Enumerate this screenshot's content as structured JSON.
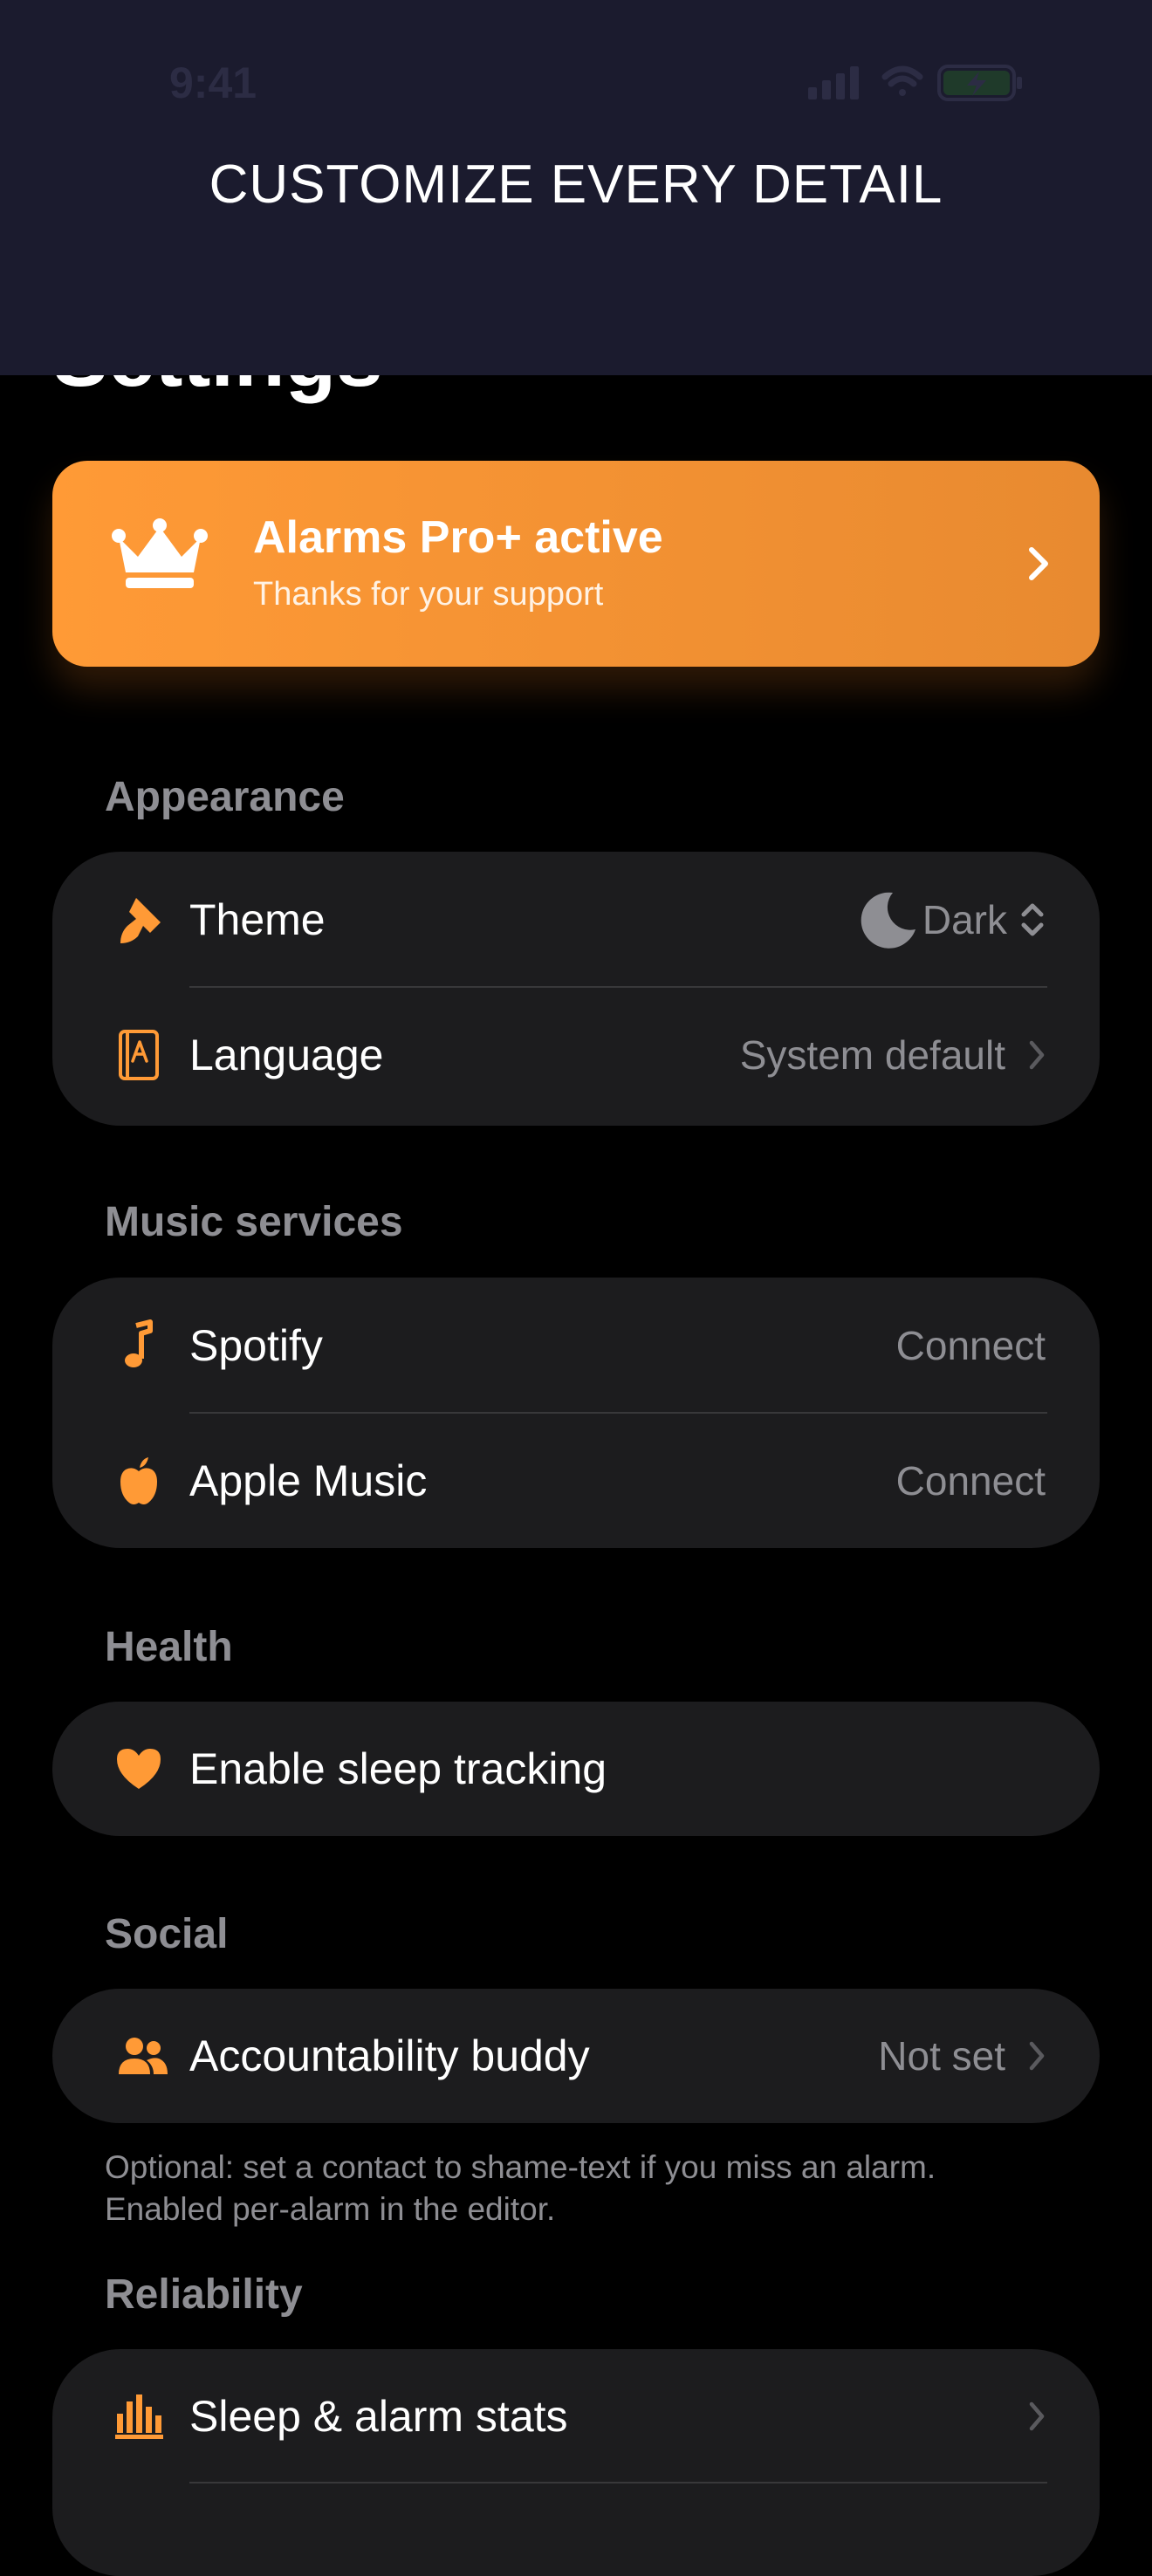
{
  "status_bar": {
    "time": "9:41"
  },
  "banner": {
    "title": "CUSTOMIZE EVERY DETAIL"
  },
  "page": {
    "title": "Settings"
  },
  "pro_card": {
    "title": "Alarms Pro+ active",
    "subtitle": "Thanks for your support"
  },
  "sections": {
    "appearance": {
      "label": "Appearance",
      "theme": {
        "label": "Theme",
        "value": "Dark"
      },
      "language": {
        "label": "Language",
        "value": "System default"
      }
    },
    "music": {
      "label": "Music services",
      "spotify": {
        "label": "Spotify",
        "value": "Connect"
      },
      "apple_music": {
        "label": "Apple Music",
        "value": "Connect"
      }
    },
    "health": {
      "label": "Health",
      "sleep": {
        "label": "Enable sleep tracking"
      }
    },
    "social": {
      "label": "Social",
      "buddy": {
        "label": "Accountability buddy",
        "value": "Not set"
      },
      "footnote_line1": "Optional: set a contact to shame-text if you miss an alarm.",
      "footnote_line2": "Enabled per-alarm in the editor."
    },
    "reliability": {
      "label": "Reliability",
      "stats": {
        "label": "Sleep & alarm stats"
      }
    }
  },
  "colors": {
    "accent": "#ff9a36",
    "background": "#000000",
    "card": "#1c1c1e",
    "secondary_text": "#8e8e93",
    "banner": "#1b1b2e"
  },
  "icons": {
    "pro": "crown-icon",
    "theme": "paintbrush-icon",
    "theme_value": "moon-icon",
    "language": "book-icon",
    "spotify": "music-note-icon",
    "apple_music": "apple-icon",
    "health": "heart-icon",
    "social": "people-icon",
    "reliability": "chart-bars-icon"
  }
}
